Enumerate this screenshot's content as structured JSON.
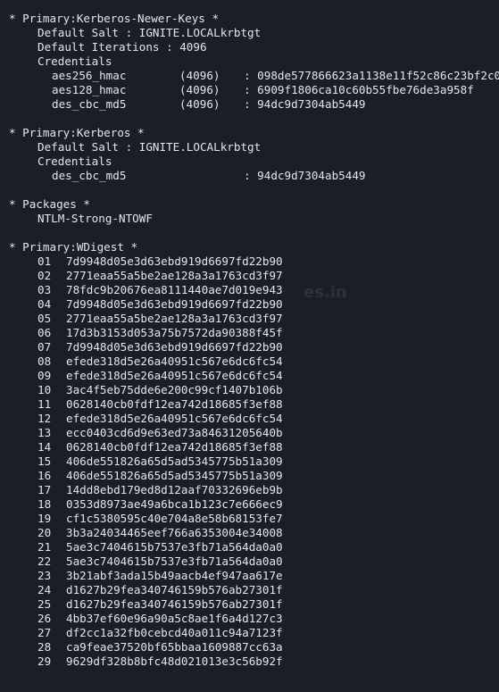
{
  "terminal": {
    "watermark": "es.in",
    "kerberos_newer_keys": {
      "header": "* Primary:Kerberos-Newer-Keys *",
      "default_salt": "Default Salt : IGNITE.LOCALkrbtgt",
      "default_iterations": "Default Iterations : 4096",
      "credentials_label": "Credentials",
      "credentials": [
        {
          "name": "aes256_hmac",
          "iter": "(4096)",
          "value": ": 098de577866623a1138e11f52c86c23bf2c0"
        },
        {
          "name": "aes128_hmac",
          "iter": "(4096)",
          "value": ": 6909f1806ca10c60b55fbe76de3a958f"
        },
        {
          "name": "des_cbc_md5",
          "iter": "(4096)",
          "value": ": 94dc9d7304ab5449"
        }
      ]
    },
    "kerberos": {
      "header": "* Primary:Kerberos *",
      "default_salt": "Default Salt : IGNITE.LOCALkrbtgt",
      "credentials_label": "Credentials",
      "credentials": [
        {
          "name": "des_cbc_md5",
          "iter": "",
          "value": ": 94dc9d7304ab5449"
        }
      ]
    },
    "packages": {
      "header": "* Packages *",
      "value": "NTLM-Strong-NTOWF"
    },
    "wdigest": {
      "header": "* Primary:WDigest *",
      "hashes": [
        {
          "num": "01",
          "hash": "7d9948d05e3d63ebd919d6697fd22b90"
        },
        {
          "num": "02",
          "hash": "2771eaa55a5be2ae128a3a1763cd3f97"
        },
        {
          "num": "03",
          "hash": "78fdc9b20676ea8111440ae7d019e943"
        },
        {
          "num": "04",
          "hash": "7d9948d05e3d63ebd919d6697fd22b90"
        },
        {
          "num": "05",
          "hash": "2771eaa55a5be2ae128a3a1763cd3f97"
        },
        {
          "num": "06",
          "hash": "17d3b3153d053a75b7572da90388f45f"
        },
        {
          "num": "07",
          "hash": "7d9948d05e3d63ebd919d6697fd22b90"
        },
        {
          "num": "08",
          "hash": "efede318d5e26a40951c567e6dc6fc54"
        },
        {
          "num": "09",
          "hash": "efede318d5e26a40951c567e6dc6fc54"
        },
        {
          "num": "10",
          "hash": "3ac4f5eb75dde6e200c99cf1407b106b"
        },
        {
          "num": "11",
          "hash": "0628140cb0fdf12ea742d18685f3ef88"
        },
        {
          "num": "12",
          "hash": "efede318d5e26a40951c567e6dc6fc54"
        },
        {
          "num": "13",
          "hash": "ecc0403cd6d9e63ed73a84631205640b"
        },
        {
          "num": "14",
          "hash": "0628140cb0fdf12ea742d18685f3ef88"
        },
        {
          "num": "15",
          "hash": "406de551826a65d5ad5345775b51a309"
        },
        {
          "num": "16",
          "hash": "406de551826a65d5ad5345775b51a309"
        },
        {
          "num": "17",
          "hash": "14dd8ebd179ed8d12aaf70332696eb9b"
        },
        {
          "num": "18",
          "hash": "0353d8973ae49a6bca1b123c7e666ec9"
        },
        {
          "num": "19",
          "hash": "cf1c5380595c40e704a8e58b68153fe7"
        },
        {
          "num": "20",
          "hash": "3b3a24034465eef766a6353004e34008"
        },
        {
          "num": "21",
          "hash": "5ae3c7404615b7537e3fb71a564da0a0"
        },
        {
          "num": "22",
          "hash": "5ae3c7404615b7537e3fb71a564da0a0"
        },
        {
          "num": "23",
          "hash": "3b21abf3ada15b49aacb4ef947aa617e"
        },
        {
          "num": "24",
          "hash": "d1627b29fea340746159b576ab27301f"
        },
        {
          "num": "25",
          "hash": "d1627b29fea340746159b576ab27301f"
        },
        {
          "num": "26",
          "hash": "4bb37ef60e96a90a5c8ae1f6a4d127c3"
        },
        {
          "num": "27",
          "hash": "df2cc1a32fb0cebcd40a011c94a7123f"
        },
        {
          "num": "28",
          "hash": "ca9feae37520bf65bbaa1609887cc63a"
        },
        {
          "num": "29",
          "hash": "9629df328b8bfc48d021013e3c56b92f"
        }
      ]
    }
  }
}
